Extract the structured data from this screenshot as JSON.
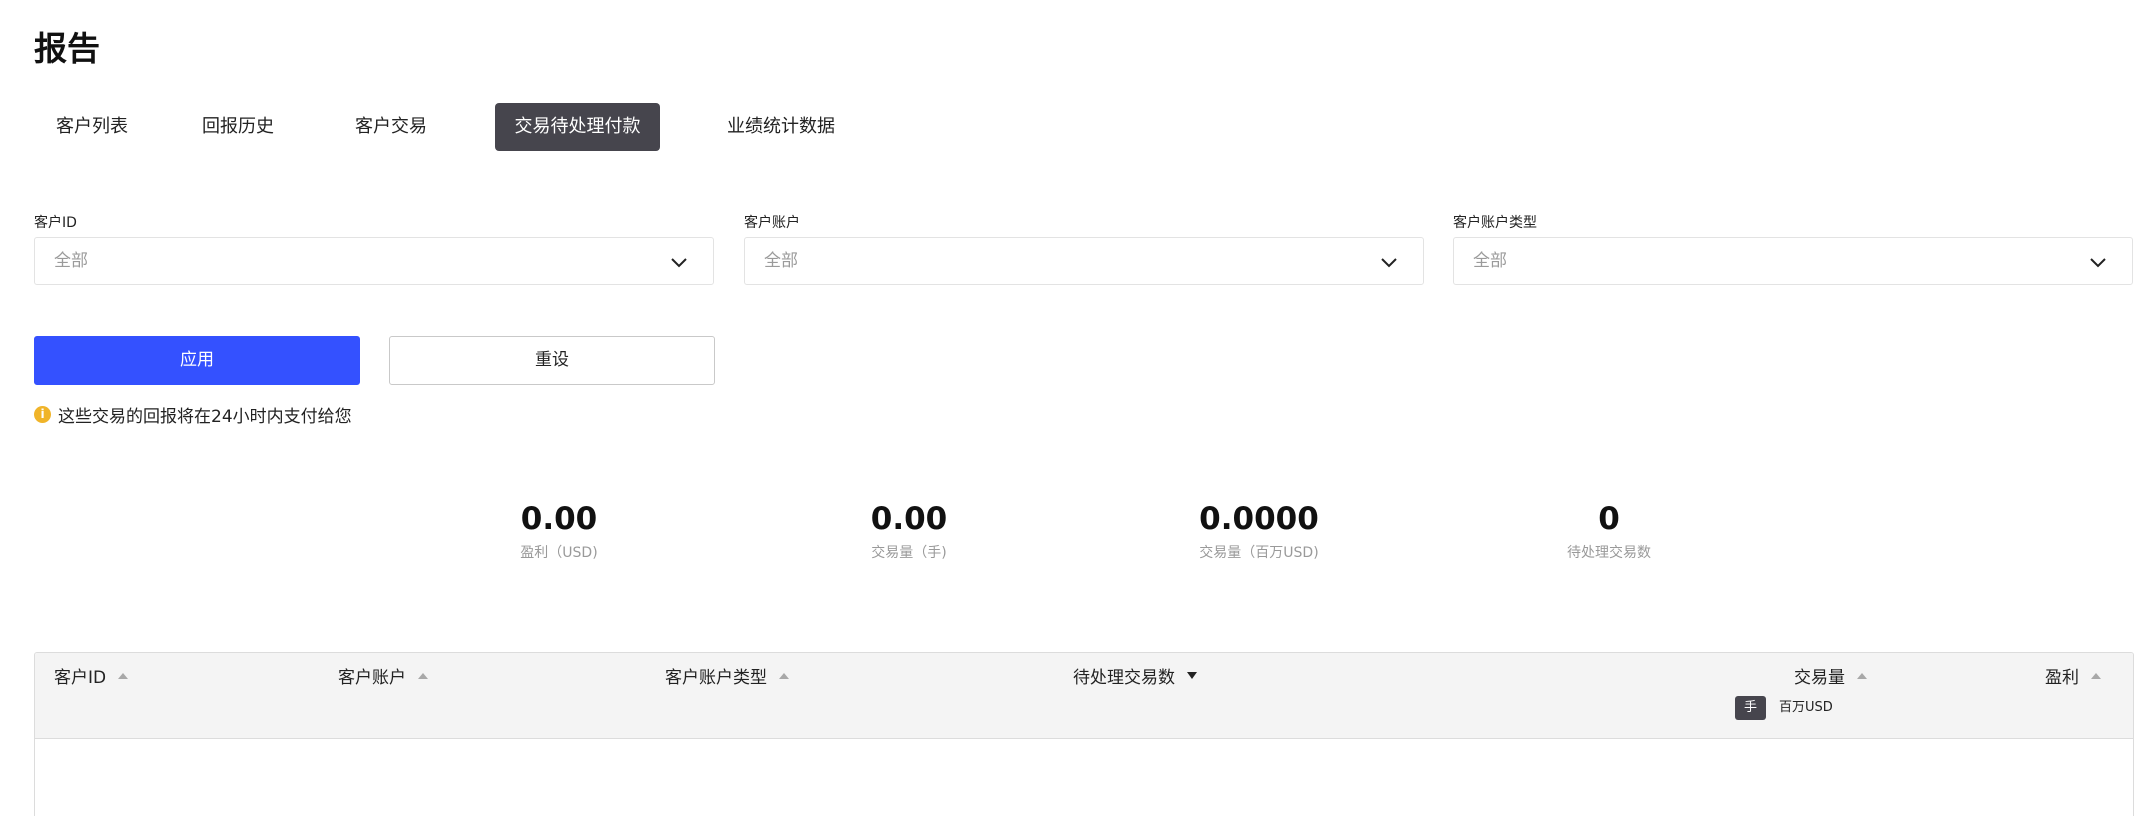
{
  "page": {
    "title": "报告"
  },
  "tabs": [
    {
      "label": "客户列表",
      "active": false
    },
    {
      "label": "回报历史",
      "active": false
    },
    {
      "label": "客户交易",
      "active": false
    },
    {
      "label": "交易待处理付款",
      "active": true
    },
    {
      "label": "业绩统计数据",
      "active": false
    }
  ],
  "filters": [
    {
      "label": "客户ID",
      "value": "全部"
    },
    {
      "label": "客户账户",
      "value": "全部"
    },
    {
      "label": "客户账户类型",
      "value": "全部"
    }
  ],
  "buttons": {
    "apply": "应用",
    "reset": "重设"
  },
  "notice": {
    "icon": "info-icon",
    "text": "这些交易的回报将在24小时内支付给您",
    "color": "#f0b429"
  },
  "stats": [
    {
      "value": "0.00",
      "label": "盈利（USD)"
    },
    {
      "value": "0.00",
      "label": "交易量（手)"
    },
    {
      "value": "0.0000",
      "label": "交易量（百万USD)"
    },
    {
      "value": "0",
      "label": "待处理交易数"
    }
  ],
  "table": {
    "columns": [
      {
        "label": "客户ID",
        "sort": "none"
      },
      {
        "label": "客户账户",
        "sort": "none"
      },
      {
        "label": "客户账户类型",
        "sort": "none"
      },
      {
        "label": "待处理交易数",
        "sort": "desc"
      },
      {
        "label": "交易量",
        "sort": "none"
      },
      {
        "label": "盈利",
        "sort": "none"
      }
    ],
    "volume_units": {
      "options": [
        "手",
        "百万USD"
      ],
      "selected": "手"
    },
    "rows": []
  },
  "colors": {
    "accent": "#3451ff",
    "active_tab": "#46454d"
  }
}
